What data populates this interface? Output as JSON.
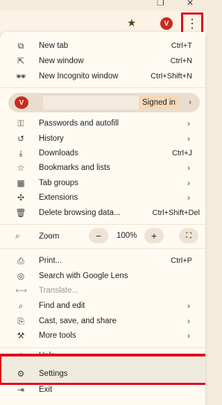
{
  "toolbar": {
    "star_icon": "star-icon",
    "avatar_letter": "V",
    "kebab_icon": "vertical-dots-icon"
  },
  "menu": {
    "group1": [
      {
        "label": "New tab",
        "shortcut": "Ctrl+T",
        "icon": "⧉"
      },
      {
        "label": "New window",
        "shortcut": "Ctrl+N",
        "icon": "⇱"
      },
      {
        "label": "New Incognito window",
        "shortcut": "Ctrl+Shift+N",
        "icon": "🕶"
      }
    ],
    "profile": {
      "avatar_letter": "V",
      "status": "Signed in"
    },
    "group2": [
      {
        "label": "Passwords and autofill",
        "icon": "⚿"
      },
      {
        "label": "History",
        "icon": "↺"
      },
      {
        "label": "Downloads",
        "shortcut": "Ctrl+J",
        "icon": "⤓"
      },
      {
        "label": "Bookmarks and lists",
        "icon": "☆"
      },
      {
        "label": "Tab groups",
        "icon": "▦"
      },
      {
        "label": "Extensions",
        "icon": "✣"
      },
      {
        "label": "Delete browsing data...",
        "shortcut": "Ctrl+Shift+Del",
        "icon": "🗑"
      }
    ],
    "zoom": {
      "label": "Zoom",
      "value": "100%",
      "minus": "−",
      "plus": "+",
      "fullscreen": "⛶"
    },
    "group3": [
      {
        "label": "Print...",
        "shortcut": "Ctrl+P",
        "icon": "⎙"
      },
      {
        "label": "Search with Google Lens",
        "icon": "◎"
      },
      {
        "label": "Translate...",
        "icon": "⟷"
      },
      {
        "label": "Find and edit",
        "icon": "⌕"
      },
      {
        "label": "Cast, save, and share",
        "icon": "⎘"
      },
      {
        "label": "More tools",
        "icon": "⚒"
      }
    ],
    "group4": [
      {
        "label": "Help",
        "icon": "?"
      },
      {
        "label": "Settings",
        "icon": "⚙"
      },
      {
        "label": "Exit",
        "icon": "⇥"
      }
    ]
  }
}
